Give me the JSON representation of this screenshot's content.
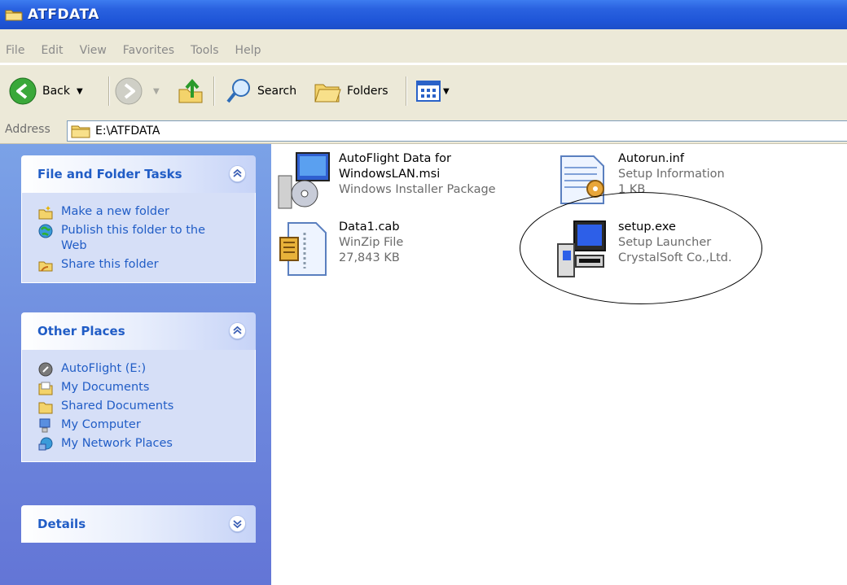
{
  "window": {
    "title": "ATFDATA"
  },
  "menu": [
    "File",
    "Edit",
    "View",
    "Favorites",
    "Tools",
    "Help"
  ],
  "toolbar": {
    "back_label": "Back",
    "search_label": "Search",
    "folders_label": "Folders"
  },
  "address": {
    "label": "Address",
    "value": "E:\\ATFDATA"
  },
  "panels": {
    "tasks": {
      "title": "File and Folder Tasks",
      "items": [
        "Make a new folder",
        "Publish this folder to the Web",
        "Share this folder"
      ]
    },
    "places": {
      "title": "Other Places",
      "items": [
        "AutoFlight (E:)",
        "My Documents",
        "Shared Documents",
        "My Computer",
        "My Network Places"
      ]
    },
    "details": {
      "title": "Details"
    }
  },
  "files": [
    {
      "name": "AutoFlight Data for WindowsLAN.msi",
      "type": "Windows Installer Package",
      "icon": "installer-icon"
    },
    {
      "name": "Autorun.inf",
      "type": "Setup Information",
      "size": "1 KB",
      "icon": "setup-info-icon"
    },
    {
      "name": "Data1.cab",
      "type": "WinZip File",
      "size": "27,843 KB",
      "icon": "cab-archive-icon"
    },
    {
      "name": "setup.exe",
      "type": "Setup Launcher",
      "company": "CrystalSoft Co.,Ltd.",
      "icon": "setup-launcher-icon"
    }
  ],
  "colors": {
    "titlebar": "#2a62e0",
    "chrome": "#ece9d8",
    "pane": "#6d8ee0",
    "link": "#215dc6"
  }
}
